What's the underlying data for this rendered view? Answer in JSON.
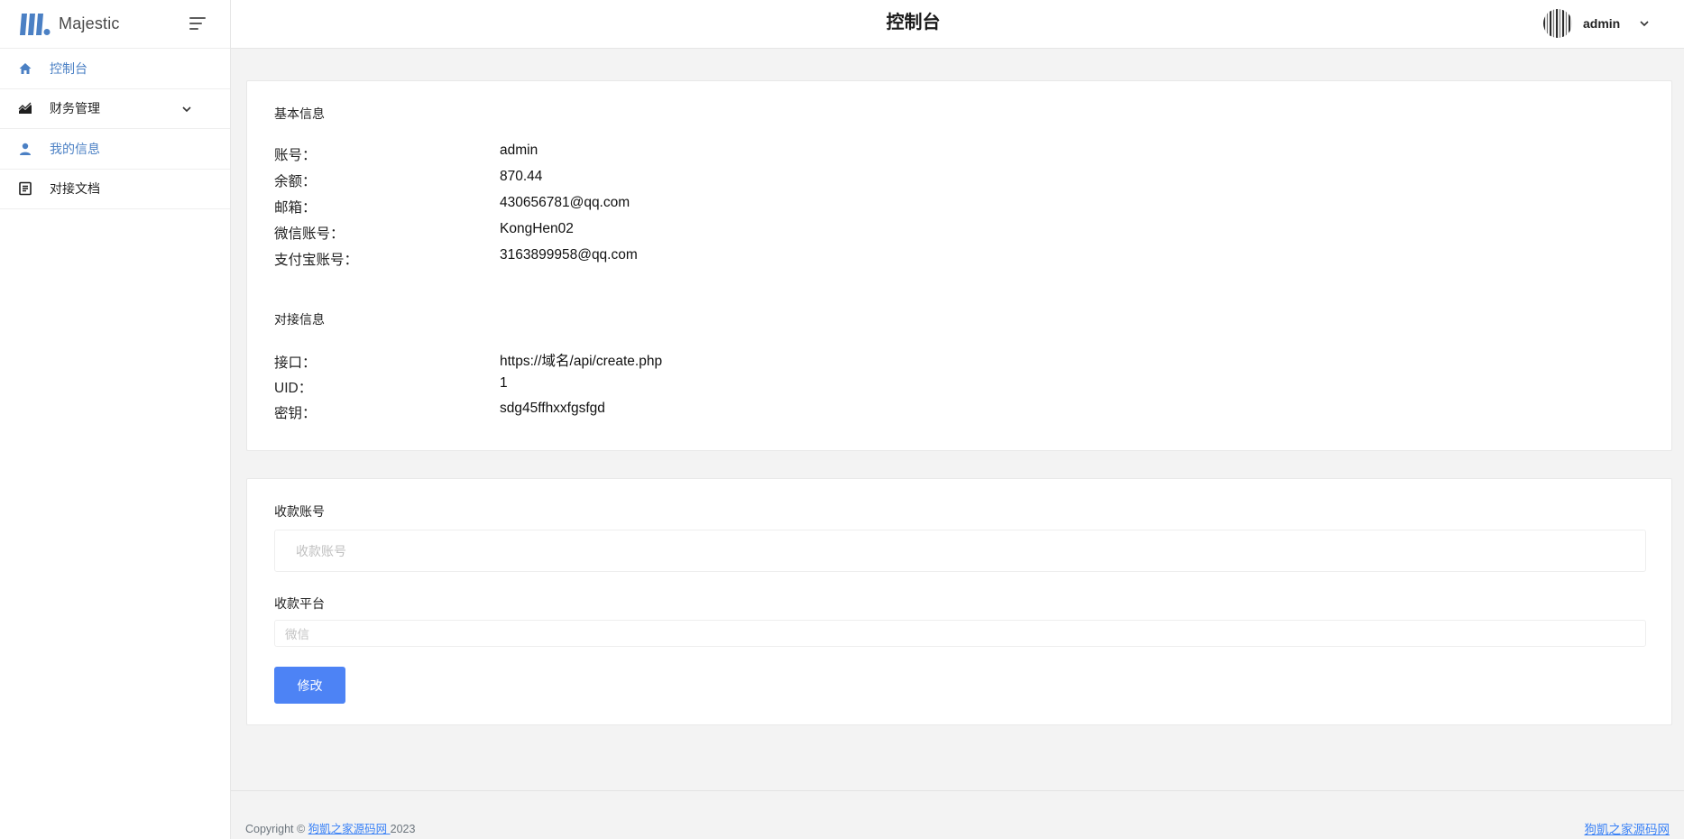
{
  "brand": {
    "name": "Majestic",
    "logo_icon": "majestic-logo",
    "accent": "#4b80c4"
  },
  "sidebar": {
    "items": [
      {
        "label": "控制台",
        "icon": "home-icon"
      },
      {
        "label": "财务管理",
        "icon": "chart-area-icon",
        "caret": "chevron-down-icon"
      },
      {
        "label": "我的信息",
        "icon": "user-icon"
      },
      {
        "label": "对接文档",
        "icon": "document-icon"
      }
    ]
  },
  "header": {
    "title": "控制台",
    "user": {
      "name": "admin"
    }
  },
  "basic_info": {
    "section_title": "基本信息",
    "rows": [
      {
        "label": "账号：",
        "value": "admin"
      },
      {
        "label": "余额：",
        "value": "870.44"
      },
      {
        "label": "邮箱：",
        "value": "430656781@qq.com"
      },
      {
        "label": "微信账号：",
        "value": "KongHen02"
      },
      {
        "label": "支付宝账号：",
        "value": "3163899958@qq.com"
      }
    ]
  },
  "integration_info": {
    "section_title": "对接信息",
    "rows": [
      {
        "label": "接口：",
        "value": "https://域名/api/create.php"
      },
      {
        "label": "UID：",
        "value": "1"
      },
      {
        "label": "密钥：",
        "value": "sdg45ffhxxfgsfgd"
      }
    ]
  },
  "payment_form": {
    "account_label": "收款账号",
    "account_placeholder": "收款账号",
    "account_value": "",
    "platform_label": "收款平台",
    "platform_selected": "微信",
    "submit_label": "修改",
    "submit_color": "#4d83f5"
  },
  "footer": {
    "copyright_prefix": "Copyright © ",
    "site_link": "狗凱之家源码网 ",
    "year": "2023",
    "right_link": "狗凱之家源码网"
  }
}
